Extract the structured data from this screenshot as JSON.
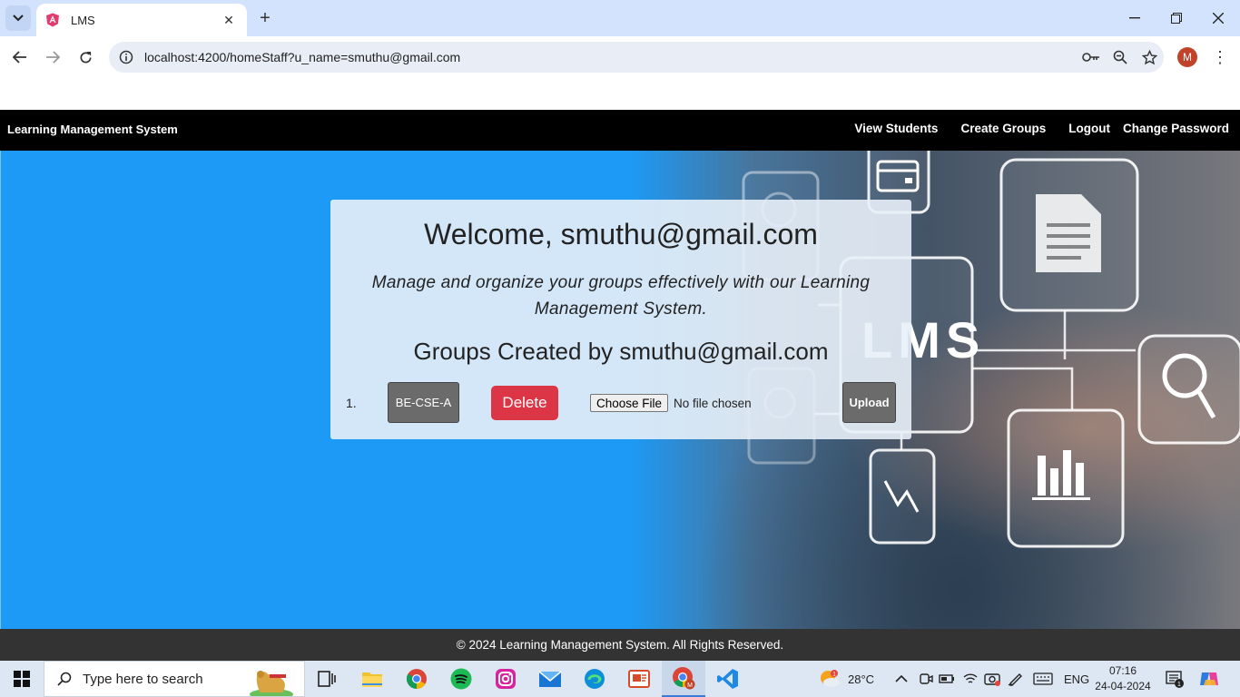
{
  "browser": {
    "tab_title": "LMS",
    "url": "localhost:4200/homeStaff?u_name=smuthu@gmail.com",
    "profile_initial": "M"
  },
  "navbar": {
    "brand": "Learning Management System",
    "links": [
      "View Students",
      "Create Groups",
      "Logout",
      "Change Password"
    ]
  },
  "card": {
    "welcome": "Welcome, smuthu@gmail.com",
    "tagline": "Manage and organize your groups effectively with our Learning Management System.",
    "groups_heading": "Groups Created by smuthu@gmail.com",
    "groups": [
      {
        "index": "1.",
        "name": "BE-CSE-A",
        "delete_label": "Delete",
        "file_button": "Choose File",
        "file_status": "No file chosen",
        "upload_label": "Upload"
      }
    ]
  },
  "hero_image_text": "LMS",
  "footer": {
    "text": "© 2024 Learning Management System. All Rights Reserved."
  },
  "taskbar": {
    "search_placeholder": "Type here to search",
    "weather_temp": "28°C",
    "weather_badge": "1",
    "language": "ENG",
    "time": "07:16",
    "date": "24-04-2024",
    "notification_count": "1"
  },
  "colors": {
    "hero_blue": "#1c9af5",
    "navbar": "#000000",
    "delete": "#dc3545",
    "footer": "#333333"
  }
}
